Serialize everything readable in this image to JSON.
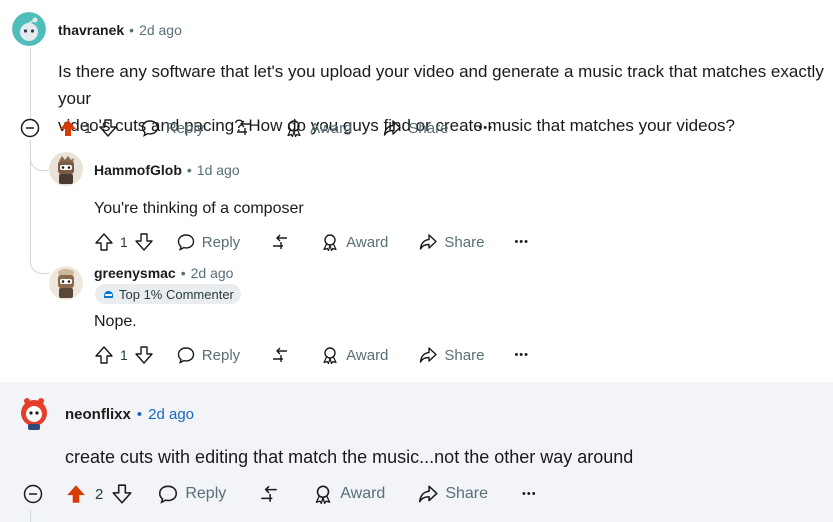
{
  "comments": [
    {
      "username": "thavranek",
      "time": "2d ago",
      "separator": "•",
      "text_line1": "Is there any software that let's you upload your video and generate a music track that matches exactly your",
      "text_line2": "video's cuts and pacing? How do you guys find or create music that matches your videos?",
      "votes": "1",
      "upvoted": true
    },
    {
      "username": "HammofGlob",
      "time": "1d ago",
      "separator": "•",
      "text": "You're thinking of a composer",
      "votes": "1"
    },
    {
      "username": "greenysmac",
      "time": "2d ago",
      "separator": "•",
      "badge": "Top 1% Commenter",
      "text": "Nope.",
      "votes": "1"
    },
    {
      "username": "neonflixx",
      "time": "2d ago",
      "separator": "•",
      "text": "create cuts with editing that match the music...not the other way around",
      "votes": "2",
      "upvoted": true
    }
  ],
  "actions": {
    "reply": "Reply",
    "award": "Award",
    "share": "Share",
    "more": "•••"
  },
  "colors": {
    "upvote_active": "#d93a00",
    "meta_text": "#576f76",
    "highlight_bg": "#f2f4f8",
    "thread_line": "#d0d7de"
  }
}
